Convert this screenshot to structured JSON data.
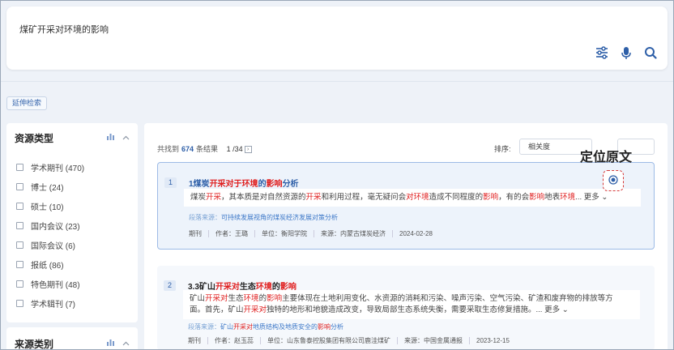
{
  "search": {
    "query": "煤矿开采对环境的影响"
  },
  "extend_search_label": "延伸检索",
  "sidebar": {
    "title": "资源类型",
    "items": [
      {
        "label": "学术期刊 (470)"
      },
      {
        "label": "博士 (24)"
      },
      {
        "label": "硕士 (10)"
      },
      {
        "label": "国内会议 (23)"
      },
      {
        "label": "国际会议 (6)"
      },
      {
        "label": "报纸 (86)"
      },
      {
        "label": "特色期刊 (48)"
      },
      {
        "label": "学术辑刊 (7)"
      }
    ],
    "section2_title": "来源类别"
  },
  "results": {
    "found_prefix": "共找到",
    "count": "674",
    "found_suffix": "条结果",
    "page": "1 /34",
    "sort_label": "排序:",
    "sort_value": "相关度"
  },
  "locate_label": "定位原文",
  "cards": [
    {
      "num": "1",
      "title_parts": [
        "1煤炭",
        "开采对于",
        "环境",
        "的",
        "影响",
        "分析"
      ],
      "body_parts": [
        "煤炭",
        "开采",
        "，其本质是对自然资源的",
        "开采",
        "和利用过程，毫无疑问会",
        "对环境",
        "造成不同程度的",
        "影响",
        "，有的会",
        "影响",
        "地表",
        "环境",
        "..."
      ],
      "more": "更多",
      "src_prefix": "段落来源：",
      "src_link": "可持续发展视角的煤炭经济发展对策分析",
      "meta": [
        "期刊",
        "作者：王璐",
        "单位：衡阳学院",
        "来源：内蒙古煤炭经济",
        "2024-02-28"
      ]
    },
    {
      "num": "2",
      "title_parts": [
        "3.3矿山",
        "开采对",
        "生态",
        "环境",
        "的",
        "影响",
        ""
      ],
      "body_line1_parts": [
        "矿山",
        "开采对",
        "生态",
        "环境",
        "的",
        "影响",
        "主要体现在土地利用变化、水资源的消耗和污染、噪声污染、空气污染、矿渣和废弃物的排放等方"
      ],
      "body_line2_parts": [
        "面。首先，矿山",
        "开采对",
        "独特的地形和地貌造成改变，导致局部生态系统失衡，需要采取生态修复措施。..."
      ],
      "more": "更多",
      "src_prefix": "段落来源：",
      "src_link_parts": [
        "矿山",
        "开采对",
        "地质结构及地质安全的",
        "影响",
        "分析"
      ],
      "meta": [
        "期刊",
        "作者：赵玉蕊",
        "单位：山东鲁泰控股集团有限公司鹿洼煤矿",
        "来源：中国金属通报",
        "2023-12-15"
      ]
    }
  ],
  "colors": {
    "accent": "#2e5fa8",
    "highlight": "#e02020",
    "locate_border": "#d43a3a"
  }
}
